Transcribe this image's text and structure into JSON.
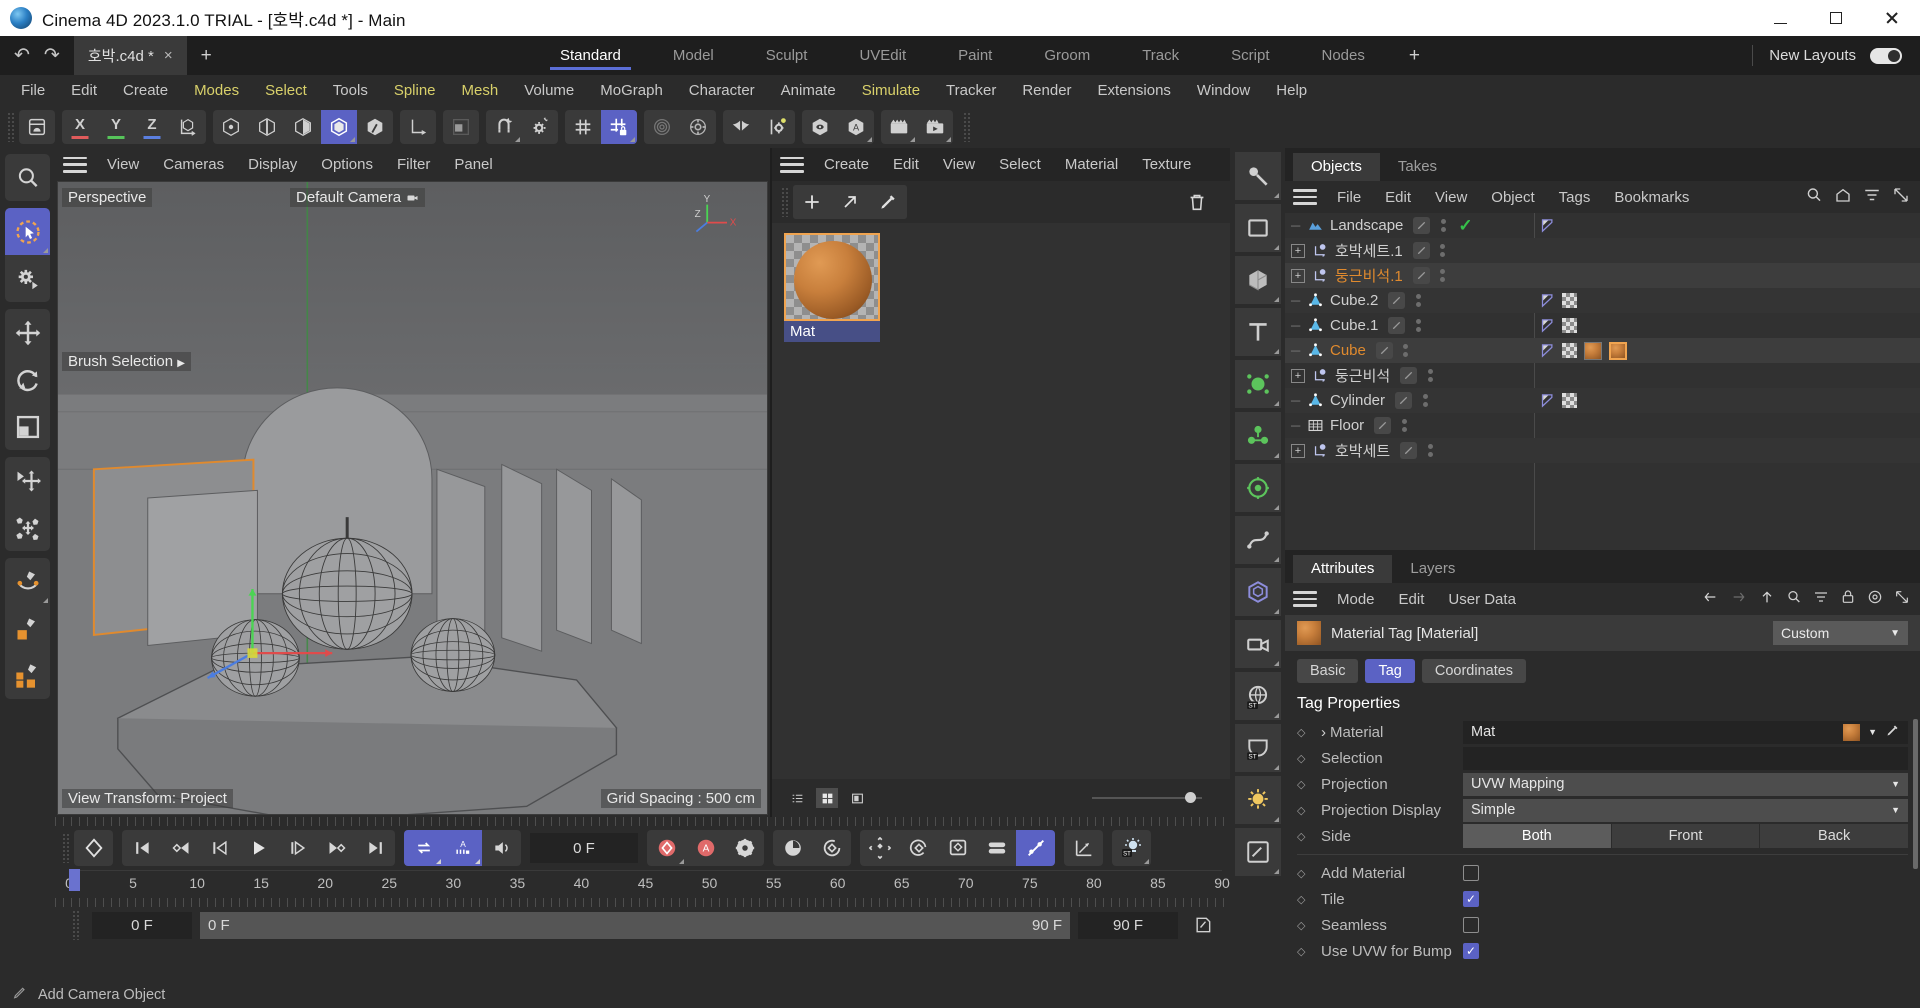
{
  "window": {
    "title": "Cinema 4D 2023.1.0 TRIAL - [호박.c4d *] - Main",
    "minimize": "minimize-icon",
    "maximize": "maximize-icon",
    "close": "close-icon"
  },
  "topbar": {
    "undo": "undo-icon",
    "redo": "redo-icon",
    "doc_tab": "호박.c4d *",
    "doc_tab_close": "×",
    "new_tab": "+",
    "layout_tabs": [
      {
        "label": "Standard",
        "active": true
      },
      {
        "label": "Model",
        "active": false
      },
      {
        "label": "Sculpt",
        "active": false
      },
      {
        "label": "UVEdit",
        "active": false
      },
      {
        "label": "Paint",
        "active": false
      },
      {
        "label": "Groom",
        "active": false
      },
      {
        "label": "Track",
        "active": false
      },
      {
        "label": "Script",
        "active": false
      },
      {
        "label": "Nodes",
        "active": false
      }
    ],
    "add_layout": "+",
    "new_layouts_label": "New Layouts",
    "new_layouts_on": true
  },
  "menubar": [
    {
      "label": "File",
      "highlight": false
    },
    {
      "label": "Edit",
      "highlight": false
    },
    {
      "label": "Create",
      "highlight": false
    },
    {
      "label": "Modes",
      "highlight": true
    },
    {
      "label": "Select",
      "highlight": true
    },
    {
      "label": "Tools",
      "highlight": false
    },
    {
      "label": "Spline",
      "highlight": true
    },
    {
      "label": "Mesh",
      "highlight": true
    },
    {
      "label": "Volume",
      "highlight": false
    },
    {
      "label": "MoGraph",
      "highlight": false
    },
    {
      "label": "Character",
      "highlight": false
    },
    {
      "label": "Animate",
      "highlight": false
    },
    {
      "label": "Simulate",
      "highlight": true
    },
    {
      "label": "Tracker",
      "highlight": false
    },
    {
      "label": "Render",
      "highlight": false
    },
    {
      "label": "Extensions",
      "highlight": false
    },
    {
      "label": "Window",
      "highlight": false
    },
    {
      "label": "Help",
      "highlight": false
    }
  ],
  "main_toolbar": [
    {
      "name": "undo-history-icon",
      "label": "",
      "selected": false
    },
    {
      "name": "axis-x-icon",
      "label": "X",
      "color": "#e05b5b",
      "selected": false
    },
    {
      "name": "axis-y-icon",
      "label": "Y",
      "color": "#56c45a",
      "selected": false
    },
    {
      "name": "axis-z-icon",
      "label": "Z",
      "color": "#5b7fe0",
      "selected": false
    },
    {
      "name": "world-object-axis-icon",
      "label": "",
      "selected": false
    },
    {
      "name": "point-mode-icon",
      "label": "",
      "selected": false
    },
    {
      "name": "edge-mode-icon",
      "label": "",
      "selected": false
    },
    {
      "name": "polygon-mode-icon",
      "label": "",
      "selected": false
    },
    {
      "name": "model-mode-icon",
      "label": "",
      "selected": true
    },
    {
      "name": "object-mode-icon",
      "label": "",
      "selected": false
    },
    {
      "name": "axis-modify-icon",
      "label": "",
      "selected": false
    },
    {
      "name": "texture-mode-icon",
      "label": "",
      "selected": false
    },
    {
      "name": "snap-enable-icon",
      "label": "",
      "selected": false
    },
    {
      "name": "snap-settings-icon",
      "label": "",
      "selected": false
    },
    {
      "name": "workplane-icon",
      "label": "",
      "selected": false
    },
    {
      "name": "workplane-lock-icon",
      "label": "",
      "selected": true
    },
    {
      "name": "deformer-icon",
      "label": "",
      "selected": false
    },
    {
      "name": "generator-settings-icon",
      "label": "",
      "selected": false
    },
    {
      "name": "symmetry-icon",
      "label": "",
      "selected": false
    },
    {
      "name": "modeling-settings-icon",
      "label": "",
      "selected": false
    },
    {
      "name": "render-view-icon",
      "label": "",
      "selected": false
    },
    {
      "name": "render-region-icon",
      "label": "",
      "selected": false
    },
    {
      "name": "render-picture-viewer-icon",
      "label": "",
      "selected": false
    },
    {
      "name": "render-settings-icon",
      "label": "",
      "selected": false
    }
  ],
  "left_tools": [
    {
      "name": "magnifier-icon",
      "selected": false
    },
    {
      "name": "live-selection-icon",
      "selected": true
    },
    {
      "name": "selection-settings-icon",
      "selected": false
    },
    {
      "name": "move-tool-icon",
      "selected": false
    },
    {
      "name": "rotate-tool-icon",
      "selected": false
    },
    {
      "name": "scale-tool-icon",
      "selected": false
    },
    {
      "name": "transform-point-icon",
      "selected": false
    },
    {
      "name": "transform-objects-icon",
      "selected": false
    },
    {
      "name": "spline-pen-icon",
      "selected": false
    },
    {
      "name": "primitive-cube-icon",
      "selected": false
    },
    {
      "name": "array-objects-icon",
      "selected": false
    }
  ],
  "viewport": {
    "menu": [
      "View",
      "Cameras",
      "Display",
      "Options",
      "Filter",
      "Panel"
    ],
    "projection_label": "Perspective",
    "camera_label": "Default Camera",
    "camera_icon": "camera-icon",
    "brush_selection": "Brush Selection",
    "view_transform": "View Transform: Project",
    "grid_spacing": "Grid Spacing : 500 cm",
    "axis_y": "Y",
    "axis_x": "X",
    "axis_z": "Z"
  },
  "material_manager": {
    "menu": [
      "Create",
      "Edit",
      "View",
      "Select",
      "Material",
      "Texture"
    ],
    "tools": [
      "new-material-icon",
      "apply-material-icon",
      "eyedropper-icon"
    ],
    "delete_icon": "trash-icon",
    "materials": [
      {
        "name": "Mat",
        "selected": true
      }
    ],
    "footer_views": [
      "list-view-icon",
      "grid-view-icon",
      "large-icon-view-icon"
    ],
    "zoom_slider": 90
  },
  "right_rail": [
    {
      "name": "light-object-icon"
    },
    {
      "name": "plane-object-icon"
    },
    {
      "name": "cube-object-icon"
    },
    {
      "name": "text-object-icon"
    },
    {
      "name": "particle-emitter-icon"
    },
    {
      "name": "cloner-icon"
    },
    {
      "name": "simulation-icon"
    },
    {
      "name": "spline-object-icon"
    },
    {
      "name": "deformer-object-icon"
    },
    {
      "name": "camera-object-icon"
    },
    {
      "name": "environment-icon"
    },
    {
      "name": "stage-icon"
    },
    {
      "name": "light-setup-icon"
    },
    {
      "name": "material-node-icon"
    }
  ],
  "objects_panel": {
    "tabs": [
      {
        "label": "Objects",
        "active": true
      },
      {
        "label": "Takes",
        "active": false
      }
    ],
    "menu": [
      "File",
      "Edit",
      "View",
      "Object",
      "Tags",
      "Bookmarks"
    ],
    "icons": [
      "search-icon",
      "home-icon",
      "filter-icon",
      "expand-icon"
    ],
    "rows": [
      {
        "name": "Landscape",
        "icon": "landscape-icon",
        "expandable": false,
        "indent": 1,
        "selected": false,
        "visible_check": true,
        "tags": [
          "flag"
        ]
      },
      {
        "name": "호박세트.1",
        "icon": "null-object-icon",
        "expandable": true,
        "indent": 0,
        "selected": false,
        "visible_check": false,
        "tags": []
      },
      {
        "name": "둥근비석.1",
        "icon": "null-object-icon",
        "expandable": true,
        "indent": 0,
        "selected": true,
        "visible_check": false,
        "tags": []
      },
      {
        "name": "Cube.2",
        "icon": "polygon-object-icon",
        "expandable": false,
        "indent": 1,
        "selected": false,
        "visible_check": false,
        "tags": [
          "flag",
          "checker"
        ]
      },
      {
        "name": "Cube.1",
        "icon": "polygon-object-icon",
        "expandable": false,
        "indent": 1,
        "selected": false,
        "visible_check": false,
        "tags": [
          "flag",
          "checker"
        ]
      },
      {
        "name": "Cube",
        "icon": "polygon-object-icon",
        "expandable": false,
        "indent": 1,
        "selected": true,
        "visible_check": false,
        "tags": [
          "flag",
          "checker",
          "material",
          "material-selected"
        ]
      },
      {
        "name": "둥근비석",
        "icon": "null-object-icon",
        "expandable": true,
        "indent": 0,
        "selected": false,
        "visible_check": false,
        "tags": []
      },
      {
        "name": "Cylinder",
        "icon": "polygon-object-icon",
        "expandable": false,
        "indent": 1,
        "selected": false,
        "visible_check": false,
        "tags": [
          "flag",
          "checker"
        ]
      },
      {
        "name": "Floor",
        "icon": "floor-object-icon",
        "expandable": false,
        "indent": 1,
        "selected": false,
        "visible_check": false,
        "tags": []
      },
      {
        "name": "호박세트",
        "icon": "null-object-icon",
        "expandable": true,
        "indent": 0,
        "selected": false,
        "visible_check": false,
        "tags": []
      }
    ]
  },
  "attributes_panel": {
    "tabs": [
      {
        "label": "Attributes",
        "active": true
      },
      {
        "label": "Layers",
        "active": false
      }
    ],
    "menu": [
      "Mode",
      "Edit",
      "User Data"
    ],
    "icons": [
      "back-arrow-icon",
      "forward-arrow-icon",
      "up-arrow-icon",
      "search-icon",
      "filter-icon",
      "lock-icon",
      "target-icon",
      "expand-icon"
    ],
    "title": "Material Tag [Material]",
    "preset_value": "Custom",
    "tabs_row": [
      {
        "label": "Basic",
        "active": false
      },
      {
        "label": "Tag",
        "active": true
      },
      {
        "label": "Coordinates",
        "active": false
      }
    ],
    "section_title": "Tag Properties",
    "fields": [
      {
        "type": "text",
        "label": "Material",
        "value": "Mat",
        "expandable": true,
        "swatch": true
      },
      {
        "type": "text",
        "label": "Selection",
        "value": "",
        "expandable": false,
        "swatch": false
      },
      {
        "type": "combo",
        "label": "Projection",
        "value": "UVW Mapping"
      },
      {
        "type": "combo",
        "label": "Projection Display",
        "value": "Simple"
      },
      {
        "type": "segment",
        "label": "Side",
        "options": [
          "Both",
          "Front",
          "Back"
        ],
        "selected": "Both"
      },
      {
        "type": "check",
        "label": "Add Material",
        "checked": false
      },
      {
        "type": "check",
        "label": "Tile",
        "checked": true
      },
      {
        "type": "check",
        "label": "Seamless",
        "checked": false
      },
      {
        "type": "check",
        "label": "Use UVW for Bump",
        "checked": true
      }
    ]
  },
  "timeline": {
    "keyframe_button": "record-keyframe-icon",
    "transport": [
      "go-to-start-icon",
      "previous-key-icon",
      "step-back-icon",
      "play-icon",
      "step-forward-icon",
      "next-key-icon",
      "go-to-end-icon"
    ],
    "toggles": [
      {
        "name": "loop-icon",
        "selected": true
      },
      {
        "name": "auto-key-frames-icon",
        "selected": true
      },
      {
        "name": "sound-icon",
        "selected": false
      }
    ],
    "current_frame": "0 F",
    "record_group": [
      {
        "name": "record-active-objects-icon",
        "selected": false
      },
      {
        "name": "autokeying-icon",
        "selected": false
      },
      {
        "name": "keyframe-settings-icon",
        "selected": false
      }
    ],
    "mode_group": [
      {
        "name": "point-level-animation-icon",
        "selected": false
      },
      {
        "name": "animation-mode-icon",
        "selected": false
      }
    ],
    "param_group": [
      {
        "name": "position-key-icon",
        "selected": false
      },
      {
        "name": "rotation-key-icon",
        "selected": false
      },
      {
        "name": "scale-key-icon",
        "selected": false
      },
      {
        "name": "parameter-key-icon",
        "selected": false
      },
      {
        "name": "pla-key-icon",
        "selected": true
      }
    ],
    "curve_group": [
      {
        "name": "f-curve-icon",
        "selected": false
      }
    ],
    "light_group": [
      {
        "name": "interactive-render-light-icon",
        "selected": false
      }
    ],
    "ruler_ticks": [
      0,
      5,
      10,
      15,
      20,
      25,
      30,
      35,
      40,
      45,
      50,
      55,
      60,
      65,
      70,
      75,
      80,
      85,
      90
    ],
    "playhead_frame": 0,
    "range_start": "0 F",
    "range_start_field": "0 F",
    "range_end_field": "90 F",
    "range_end": "90 F",
    "edit_icon": "edit-marker-icon"
  },
  "statusbar": {
    "icon": "info-icon",
    "message": "Add Camera Object"
  },
  "colors": {
    "accent": "#5b62c4",
    "selection_orange": "#e08a2e",
    "material_orange": "#c87f3c",
    "check_green": "#35c14a"
  }
}
